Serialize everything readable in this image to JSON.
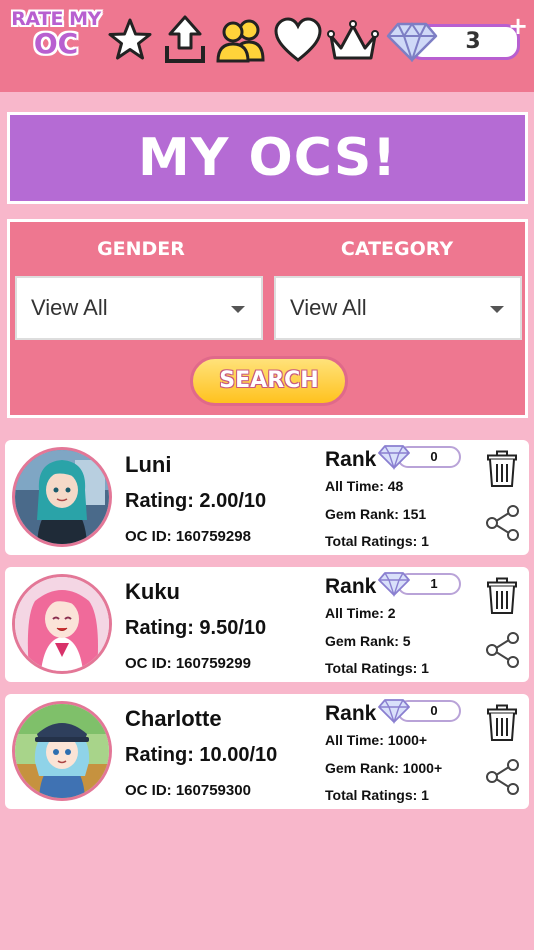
{
  "app": {
    "logo_line1": "RATE MY",
    "logo_line2": "OC",
    "gem_count": "3",
    "add_gems_label": "+"
  },
  "title": "MY OCS!",
  "filters": {
    "gender_label": "GENDER",
    "gender_value": "View All",
    "category_label": "CATEGORY",
    "category_value": "View All",
    "search_label": "SEARCH"
  },
  "rank_label": "Rank",
  "ocs": [
    {
      "name": "Luni",
      "rating": "Rating: 2.00/10",
      "oc_id": "OC ID: 160759298",
      "gems": "0",
      "all_time": "All Time: 48",
      "gem_rank": "Gem Rank: 151",
      "total_ratings": "Total Ratings: 1"
    },
    {
      "name": "Kuku",
      "rating": "Rating: 9.50/10",
      "oc_id": "OC ID: 160759299",
      "gems": "1",
      "all_time": "All Time: 2",
      "gem_rank": "Gem Rank: 5",
      "total_ratings": "Total Ratings: 1"
    },
    {
      "name": "Charlotte",
      "rating": "Rating: 10.00/10",
      "oc_id": "OC ID: 160759300",
      "gems": "0",
      "all_time": "All Time: 1000+",
      "gem_rank": "Gem Rank: 1000+",
      "total_ratings": "Total Ratings: 1"
    }
  ],
  "icons": [
    "star-icon",
    "upload-icon",
    "users-icon",
    "heart-icon",
    "crown-icon",
    "diamond-icon",
    "trash-icon",
    "share-icon"
  ],
  "colors": {
    "background": "#f8b7cb",
    "topbar": "#ee7790",
    "title_bg": "#b56bd4",
    "button_yellow": "#ffc21f"
  }
}
